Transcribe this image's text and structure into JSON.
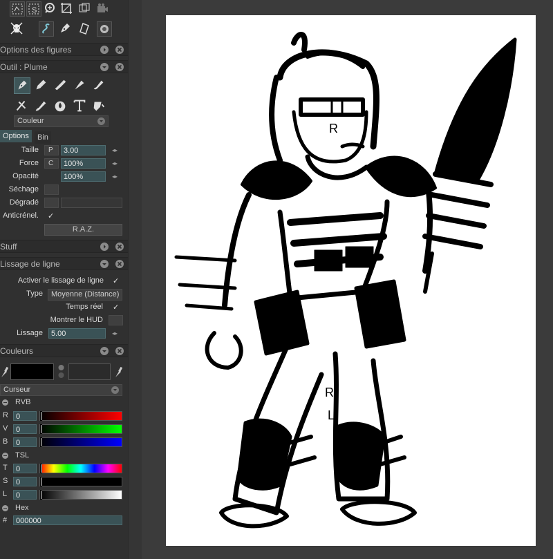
{
  "panels": {
    "shapes_options": {
      "title": "Options des figures"
    },
    "tool": {
      "title": "Outil : Plume"
    },
    "stuff": {
      "title": "Stuff"
    },
    "line_smoothing": {
      "title": "Lissage de ligne"
    },
    "colors": {
      "title": "Couleurs"
    }
  },
  "toolbar_icons": [
    "lasso-select-icon",
    "select-s-icon",
    "zoom-icon",
    "crop-icon",
    "transform-icon",
    "camera-icon",
    "skull-icon",
    "smoothing-icon",
    "pen-tool-icon",
    "ruler-icon",
    "target-icon"
  ],
  "brush_tools": [
    "pen-icon",
    "pencil-icon",
    "marker-icon",
    "airbrush-icon",
    "brush-icon",
    "eraser-icon",
    "paintbrush-icon",
    "blur-drop-icon",
    "text-icon",
    "fill-icon"
  ],
  "tool": {
    "color_mode": "Couleur",
    "tabs": [
      "Options",
      "Bin"
    ],
    "size_label": "Taille",
    "size_prefix": "P",
    "size_value": "3.00",
    "force_label": "Force",
    "force_prefix": "C",
    "force_value": "100%",
    "opacity_label": "Opacité",
    "opacity_value": "100%",
    "drying_label": "Séchage",
    "gradient_label": "Dégradé",
    "antialias_label": "Anticrénel.",
    "antialias_check": "✓",
    "reset_label": "R.A.Z."
  },
  "smoothing": {
    "enable_label": "Activer le lissage de ligne",
    "enable_check": "✓",
    "type_label": "Type",
    "type_value": "Moyenne (Distance)",
    "realtime_label": "Temps réel",
    "realtime_check": "✓",
    "hud_label": "Montrer le HUD",
    "amount_label": "Lissage",
    "amount_value": "5.00"
  },
  "colors": {
    "mode": "Curseur",
    "rgb_group": "RVB",
    "r_label": "R",
    "r_value": "0",
    "g_label": "V",
    "g_value": "0",
    "b_label": "B",
    "b_value": "0",
    "hsl_group": "TSL",
    "h_label": "T",
    "h_value": "0",
    "s_label": "S",
    "s_value": "0",
    "l_label": "L",
    "l_value": "0",
    "hex_group": "Hex",
    "hex_label": "#",
    "hex_value": "000000",
    "primary": "#000000",
    "secondary": "#2b2b2b"
  },
  "canvas": {
    "letters": [
      "R",
      "R",
      "L"
    ]
  },
  "theme": {
    "panel_bg": "#303030",
    "accent": "#3e5558",
    "canvas_bg": "#3b3b3b"
  }
}
